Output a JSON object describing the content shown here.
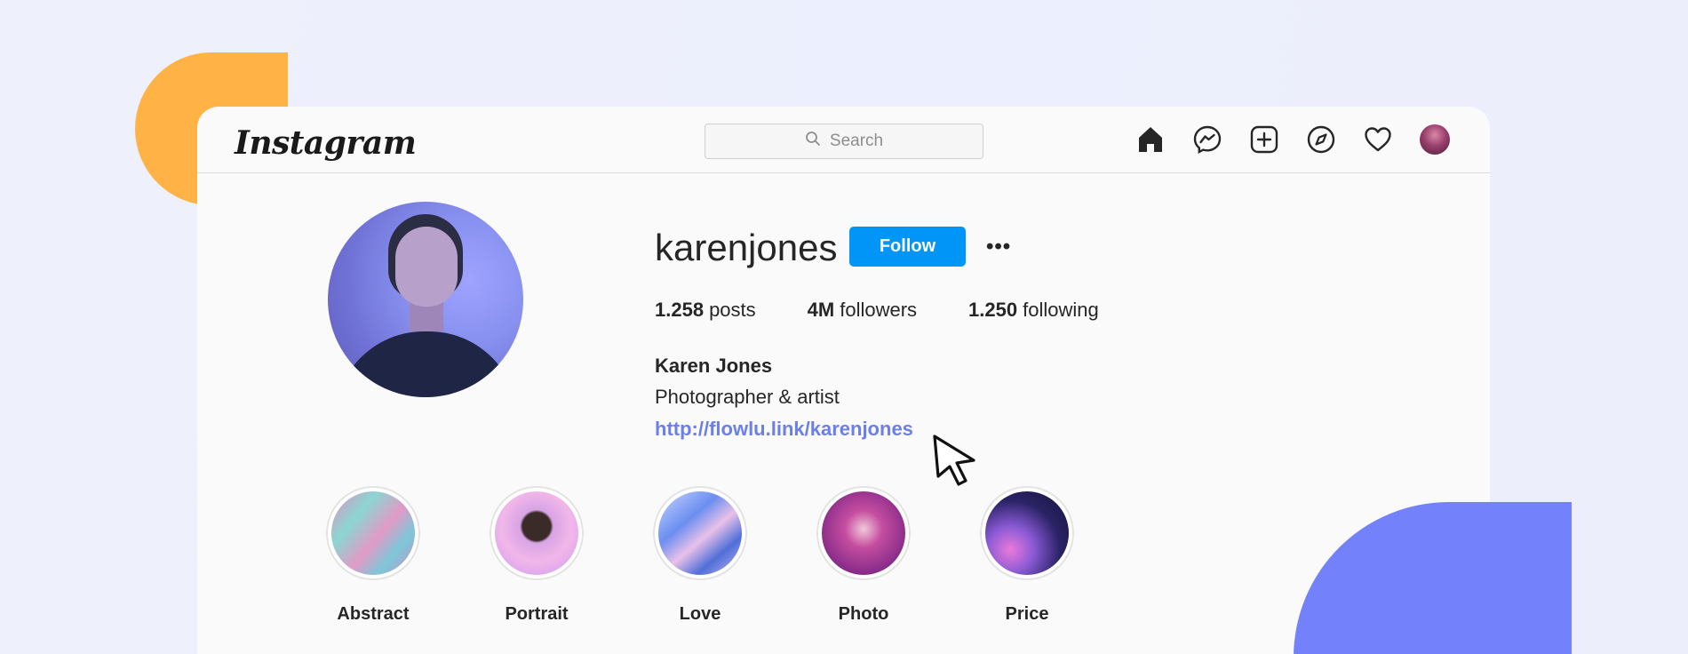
{
  "header": {
    "logo_text": "Instagram",
    "search_placeholder": "Search",
    "nav_icons": [
      "home-icon",
      "messenger-icon",
      "new-post-icon",
      "explore-icon",
      "activity-heart-icon",
      "profile-avatar"
    ]
  },
  "profile": {
    "username": "karenjones",
    "follow_label": "Follow",
    "more_label": "•••",
    "stats": {
      "posts_count": "1.258",
      "posts_label": "posts",
      "followers_count": "4M",
      "followers_label": "followers",
      "following_count": "1.250",
      "following_label": "following"
    },
    "full_name": "Karen Jones",
    "bio": "Photographer & artist",
    "link": "http://flowlu.link/karenjones"
  },
  "highlights": [
    {
      "label": "Abstract"
    },
    {
      "label": "Portrait"
    },
    {
      "label": "Love"
    },
    {
      "label": "Photo"
    },
    {
      "label": "Price"
    }
  ],
  "colors": {
    "accent_blue": "#0095f6",
    "link_color": "#6c7fe8",
    "decor_orange": "#ffb347",
    "decor_blue": "#7381fb"
  }
}
